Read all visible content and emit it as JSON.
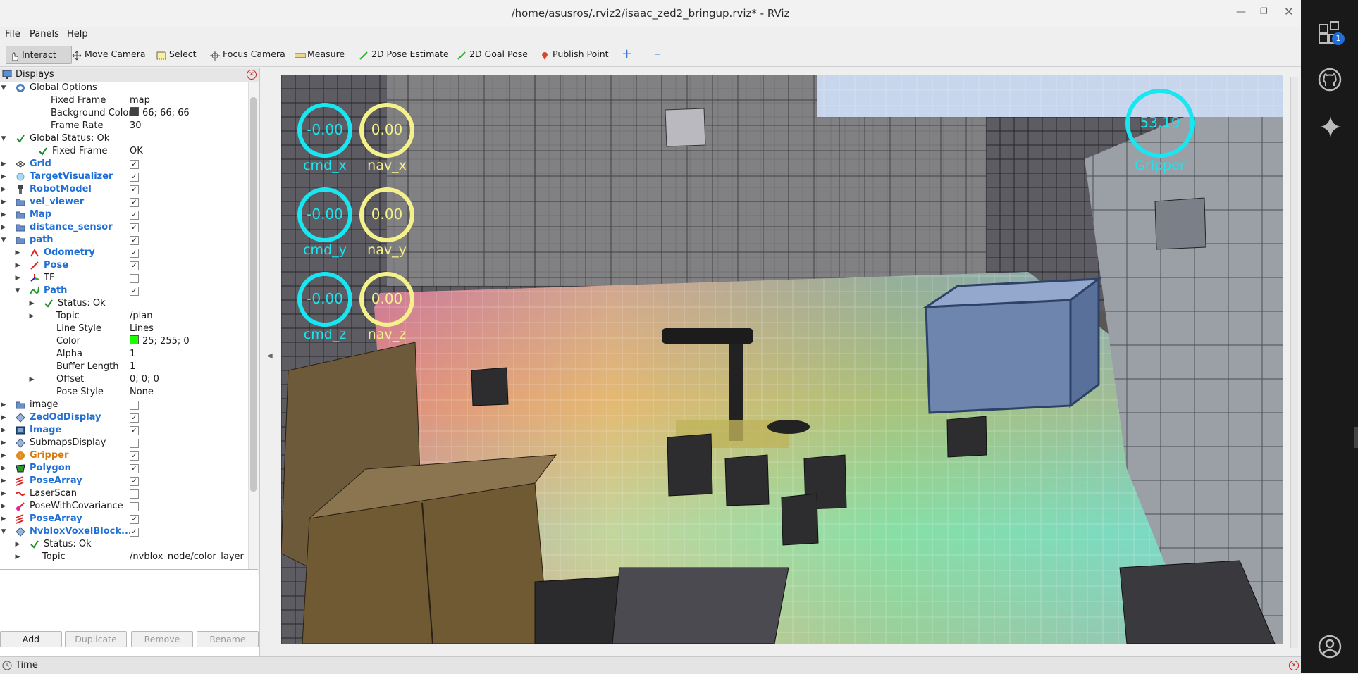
{
  "window": {
    "title": "/home/asusros/.rviz2/isaac_zed2_bringup.rviz* - RViz"
  },
  "menu": [
    "File",
    "Panels",
    "Help"
  ],
  "toolbar": {
    "interact": "Interact",
    "move_camera": "Move Camera",
    "select": "Select",
    "focus_camera": "Focus Camera",
    "measure": "Measure",
    "pose_estimate": "2D Pose Estimate",
    "goal_pose": "2D Goal Pose",
    "publish_point": "Publish Point"
  },
  "displays": {
    "title": "Displays",
    "rows": [
      {
        "label": "Global Options"
      },
      {
        "label": "Fixed Frame",
        "value": "map"
      },
      {
        "label": "Background Color",
        "value": "66; 66; 66",
        "color": "#424242"
      },
      {
        "label": "Frame Rate",
        "value": "30"
      },
      {
        "label": "Global Status: Ok"
      },
      {
        "label": "Fixed Frame",
        "value": "OK"
      },
      {
        "label": "Grid",
        "checked": true
      },
      {
        "label": "TargetVisualizer",
        "checked": true
      },
      {
        "label": "RobotModel",
        "checked": true
      },
      {
        "label": "vel_viewer",
        "checked": true
      },
      {
        "label": "Map",
        "checked": true
      },
      {
        "label": "distance_sensor",
        "checked": true
      },
      {
        "label": "path",
        "checked": true
      },
      {
        "label": "Odometry",
        "checked": true
      },
      {
        "label": "Pose",
        "checked": true
      },
      {
        "label": "TF",
        "checked": false
      },
      {
        "label": "Path",
        "checked": true
      },
      {
        "label": "Status: Ok"
      },
      {
        "label": "Topic",
        "value": "/plan"
      },
      {
        "label": "Line Style",
        "value": "Lines"
      },
      {
        "label": "Color",
        "value": "25; 255; 0",
        "color": "#19ff00"
      },
      {
        "label": "Alpha",
        "value": "1"
      },
      {
        "label": "Buffer Length",
        "value": "1"
      },
      {
        "label": "Offset",
        "value": "0; 0; 0"
      },
      {
        "label": "Pose Style",
        "value": "None"
      },
      {
        "label": "image",
        "checked": false
      },
      {
        "label": "ZedOdDisplay",
        "checked": true
      },
      {
        "label": "Image",
        "checked": true
      },
      {
        "label": "SubmapsDisplay",
        "checked": false
      },
      {
        "label": "Gripper",
        "checked": true
      },
      {
        "label": "Polygon",
        "checked": true
      },
      {
        "label": "PoseArray",
        "checked": true
      },
      {
        "label": "LaserScan",
        "checked": false
      },
      {
        "label": "PoseWithCovariance",
        "checked": false
      },
      {
        "label": "PoseArray",
        "checked": true
      },
      {
        "label": "NvbloxVoxelBlock...",
        "checked": true
      },
      {
        "label": "Status: Ok"
      },
      {
        "label": "Topic",
        "value": "/nvblox_node/color_layer"
      }
    ],
    "buttons": {
      "add": "Add",
      "duplicate": "Duplicate",
      "remove": "Remove",
      "rename": "Rename"
    }
  },
  "viewport": {
    "gauges": [
      {
        "value": "-0.00",
        "label": "cmd_x",
        "color": "#19e6f0"
      },
      {
        "value": "0.00",
        "label": "nav_x",
        "color": "#f4f08a"
      },
      {
        "value": "-0.00",
        "label": "cmd_y",
        "color": "#19e6f0"
      },
      {
        "value": "0.00",
        "label": "nav_y",
        "color": "#f4f08a"
      },
      {
        "value": "-0.00",
        "label": "cmd_z",
        "color": "#19e6f0"
      },
      {
        "value": "0.00",
        "label": "nav_z",
        "color": "#f4f08a"
      }
    ],
    "gripper": {
      "value": "53.19",
      "label": "Gripper",
      "color": "#19e6f0"
    }
  },
  "timebar": {
    "title": "Time"
  },
  "dock": {
    "badge": "1"
  }
}
